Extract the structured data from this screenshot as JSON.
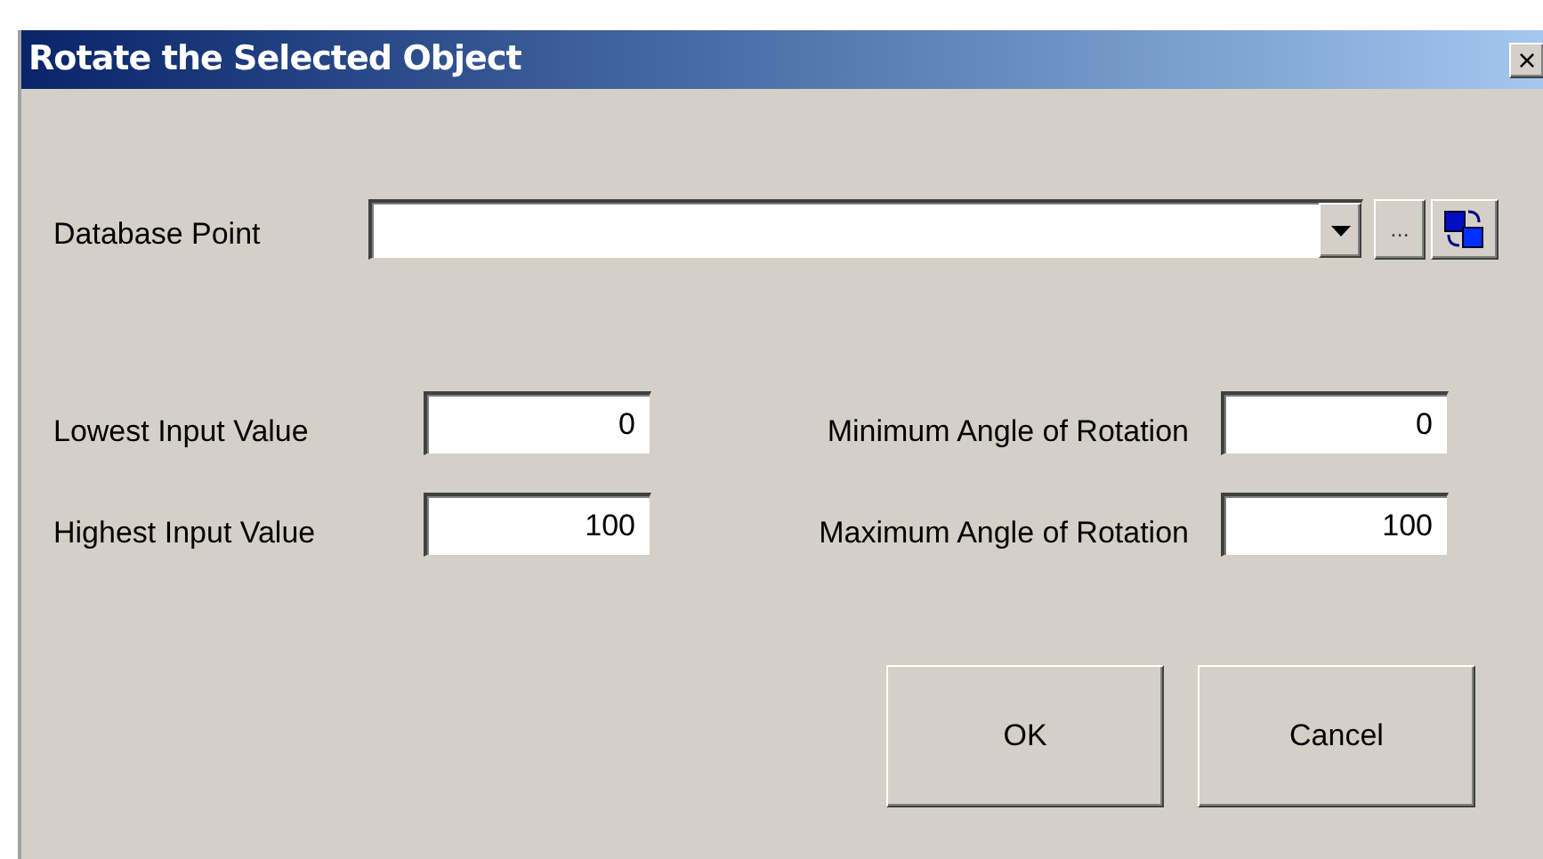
{
  "window": {
    "title": "Rotate the Selected Object",
    "close": "×"
  },
  "database_point": {
    "label": "Database Point",
    "browse": "..."
  },
  "fields": [
    {
      "label": "Lowest Input Value",
      "value": "0"
    },
    {
      "label": "Minimum Angle of Rotation",
      "value": "0"
    },
    {
      "label": "Highest Input Value",
      "value": "100"
    },
    {
      "label": "Maximum Angle of Rotation",
      "value": "100"
    }
  ],
  "buttons": [
    "OK",
    "Cancel"
  ]
}
